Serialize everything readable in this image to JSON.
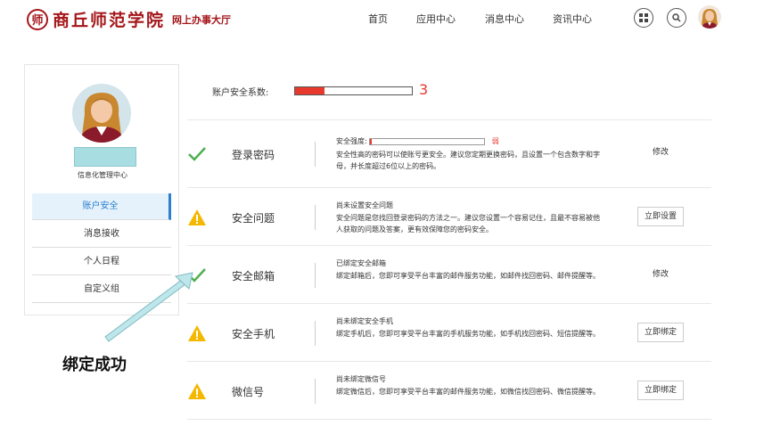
{
  "header": {
    "logo_seal": "师",
    "school_name": "商丘师范学院",
    "service_hall": "网上办事大厅",
    "nav": [
      "首页",
      "应用中心",
      "消息中心",
      "资讯中心"
    ]
  },
  "sidebar": {
    "department": "信息化管理中心",
    "menu": [
      "账户安全",
      "消息接收",
      "个人日程",
      "自定义组"
    ],
    "active_index": 0
  },
  "security": {
    "label": "账户安全系数:",
    "score": "3",
    "score_fraction": 0.25,
    "bar_color": "#e8392e"
  },
  "rows": [
    {
      "icon": "check-icon",
      "title": "登录密码",
      "status_label": "安全强度:",
      "strength_value": "弱",
      "strength_fraction": 0.02,
      "desc": "安全性高的密码可以使账号更安全。建议您定期更换密码，且设置一个包含数字和字母，并长度超过6位以上的密码。",
      "action": "修改",
      "action_style": "plain"
    },
    {
      "icon": "warning-icon",
      "title": "安全问题",
      "status": "尚未设置安全问题",
      "desc": "安全问题是您找回登录密码的方法之一。建议您设置一个容易记住，且最不容易被他人获取的问题及答案，更有效保障您的密码安全。",
      "action": "立即设置",
      "action_style": "button"
    },
    {
      "icon": "check-icon",
      "title": "安全邮箱",
      "status": "已绑定安全邮箱",
      "desc": "绑定邮箱后，您即可享受平台丰富的邮件服务功能，如邮件找回密码、邮件提醒等。",
      "action": "修改",
      "action_style": "plain"
    },
    {
      "icon": "warning-icon",
      "title": "安全手机",
      "status": "尚未绑定安全手机",
      "desc": "绑定手机后，您即可享受平台丰富的手机服务功能，如手机找回密码、短信提醒等。",
      "action": "立即绑定",
      "action_style": "button"
    },
    {
      "icon": "warning-icon",
      "title": "微信号",
      "status": "尚未绑定微信号",
      "desc": "绑定微信后，您即可享受平台丰富的邮件服务功能，如微信找回密码、微信提醒等。",
      "action": "立即绑定",
      "action_style": "button"
    }
  ],
  "annotation": "绑定成功",
  "colors": {
    "brand": "#a4161a",
    "active": "#2a7fd0",
    "check": "#4caf50",
    "warning": "#f5b800",
    "danger": "#e8392e"
  }
}
